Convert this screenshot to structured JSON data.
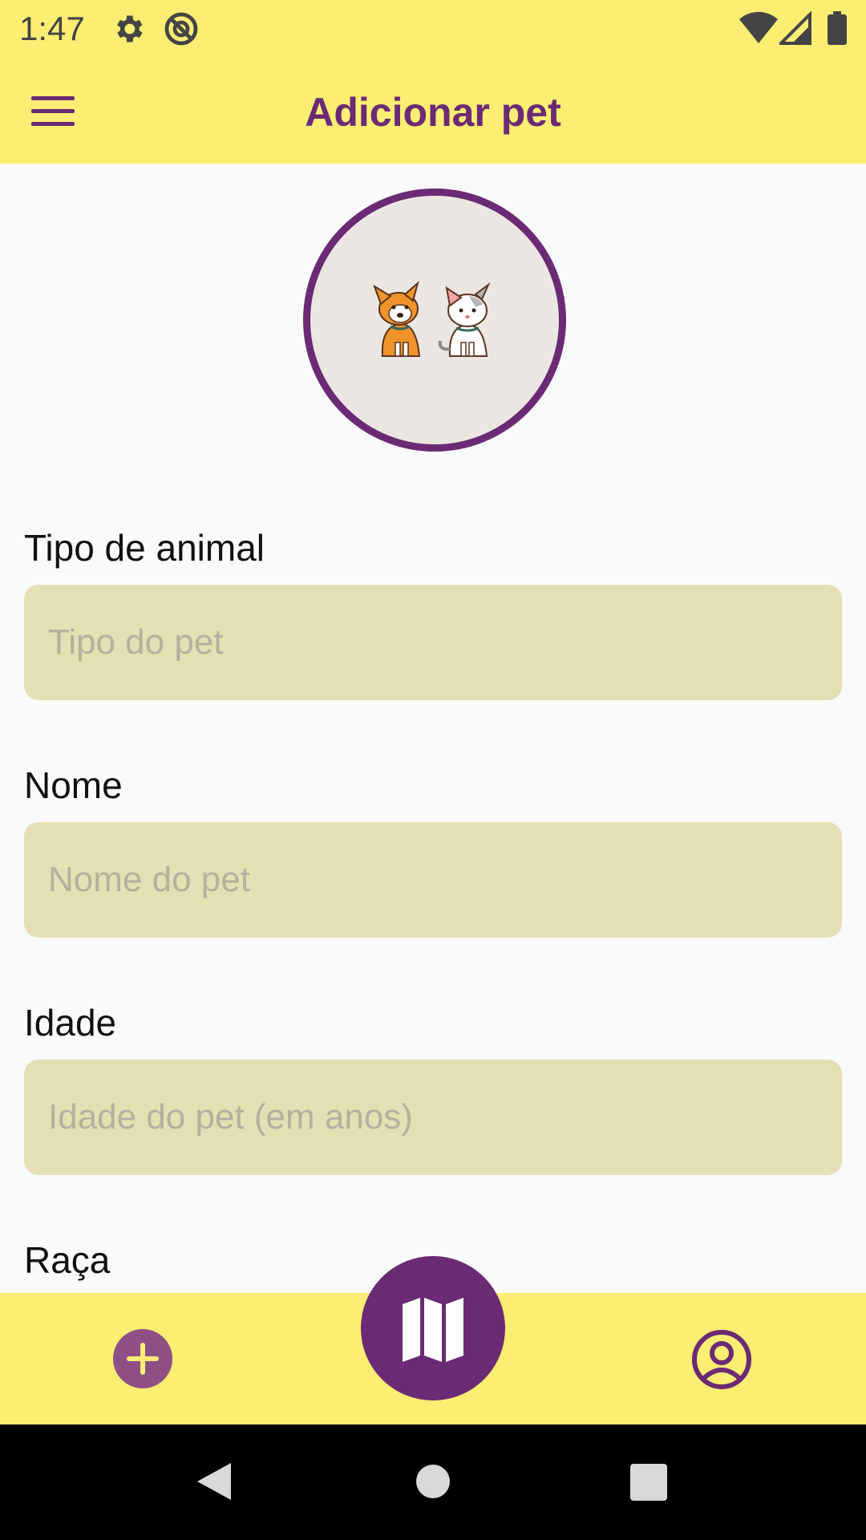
{
  "status_bar": {
    "time": "1:47",
    "left_icons": [
      "gear-icon",
      "no-data-icon"
    ],
    "right_icons": [
      "wifi-icon",
      "signal-icon",
      "battery-icon"
    ]
  },
  "app_bar": {
    "title": "Adicionar pet",
    "menu_icon": "hamburger-menu-icon"
  },
  "avatar": {
    "image": "dog-and-cat-illustration"
  },
  "form": {
    "tipo": {
      "label": "Tipo de animal",
      "placeholder": "Tipo do pet",
      "value": ""
    },
    "nome": {
      "label": "Nome",
      "placeholder": "Nome do pet",
      "value": ""
    },
    "idade": {
      "label": "Idade",
      "placeholder": "Idade do pet (em anos)",
      "value": ""
    },
    "raca": {
      "label": "Raça"
    }
  },
  "bottom_nav": {
    "items": [
      "plus-icon",
      "map-icon",
      "profile-icon"
    ]
  },
  "system_nav": {
    "items": [
      "back-icon",
      "home-icon",
      "recents-icon"
    ]
  },
  "colors": {
    "accent": "#6b2a74",
    "bar_background": "#fbee73",
    "input_background": "#e4e0b4",
    "page_background": "#faf9fb"
  }
}
